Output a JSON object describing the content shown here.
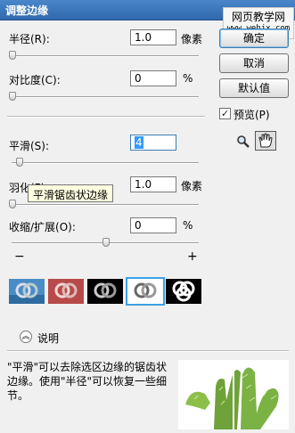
{
  "window": {
    "title": "调整边缘"
  },
  "watermark": {
    "line1": "网页教学网",
    "line2": "www.webjx.com"
  },
  "fields": {
    "radius": {
      "label": "半径(R):",
      "value": "1.0",
      "unit": "像素",
      "level": 0.02
    },
    "contrast": {
      "label": "对比度(C):",
      "value": "0",
      "unit": "%",
      "level": 0.0
    },
    "smooth": {
      "label": "平滑(S):",
      "value": "4",
      "level": 0.04
    },
    "feather": {
      "label": "羽化(F):",
      "value": "1.0",
      "unit": "像素",
      "level": 0.0
    },
    "contract_expand": {
      "label": "收缩/扩展(O):",
      "value": "0",
      "unit": "%",
      "level": 0.5
    }
  },
  "slider_ends": {
    "minus": "−",
    "plus": "+"
  },
  "tooltip": "平滑锯齿状边缘",
  "buttons": {
    "ok": "确定",
    "cancel": "取消",
    "default": "默认值"
  },
  "preview": {
    "label": "预览(P)",
    "checked": true
  },
  "tools": [
    "zoom-tool-icon",
    "hand-tool-icon"
  ],
  "view_modes": [
    "standard-mode",
    "quick-mask-mode",
    "on-black-mode",
    "on-white-mode",
    "mask-mode"
  ],
  "selected_view_mode": 3,
  "description": {
    "toggle_label": "说明",
    "text": "\"平滑\"可以去除选区边缘的锯齿状边缘。使用\"半径\"可以恢复一些细节。"
  }
}
